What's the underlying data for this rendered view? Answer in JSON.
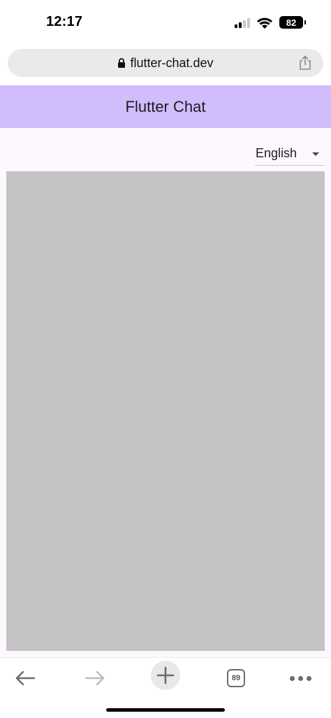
{
  "status_bar": {
    "time": "12:17",
    "battery_level": "82",
    "signal_bars_active": 2,
    "signal_bars_total": 4,
    "icons": [
      "signal-icon",
      "wifi-icon",
      "battery-icon"
    ]
  },
  "browser": {
    "url": "flutter-chat.dev",
    "icons": [
      "lock-icon",
      "share-icon"
    ]
  },
  "app_bar": {
    "title": "Flutter Chat",
    "color": "#d1bdfb"
  },
  "content": {
    "language_select": {
      "selected": "English",
      "icon": "dropdown-arrow-icon"
    },
    "canvas_color": "#c4c4c4",
    "background": "#fdf8fe"
  },
  "toolbar": {
    "tab_count": "89",
    "icons": [
      "back-arrow-icon",
      "forward-arrow-icon",
      "plus-icon",
      "tabs-icon",
      "more-icon"
    ]
  }
}
